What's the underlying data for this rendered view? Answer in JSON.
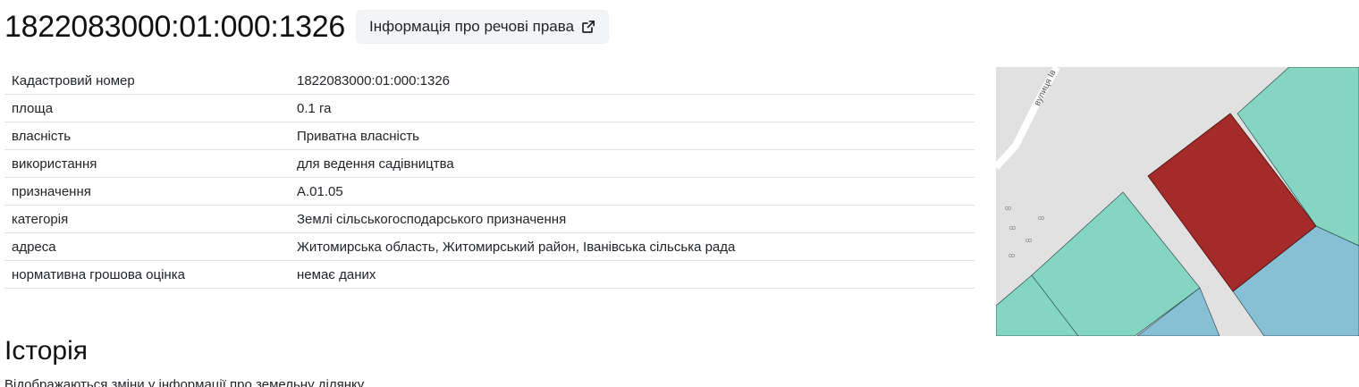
{
  "header": {
    "title": "1822083000:01:000:1326",
    "rights_button_label": "Інформація про речові права",
    "rights_button_icon": "external-link-icon"
  },
  "info_table": {
    "rows": [
      {
        "label": "Кадастровий номер",
        "value": "1822083000:01:000:1326"
      },
      {
        "label": "площа",
        "value": "0.1 га"
      },
      {
        "label": "власність",
        "value": "Приватна власність"
      },
      {
        "label": "використання",
        "value": "для ведення садівництва"
      },
      {
        "label": "призначення",
        "value": "А.01.05"
      },
      {
        "label": "категорія",
        "value": "Землі сільськогосподарського призначення"
      },
      {
        "label": "адреса",
        "value": "Житомирська область, Житомирський район, Іванівська сільська рада"
      },
      {
        "label": "нормативна грошова оцінка",
        "value": "немає даних"
      }
    ]
  },
  "map": {
    "street_label": "вулиця Ів",
    "colors": {
      "background": "#e1e1e1",
      "selected_parcel": "#a52a2a",
      "neighbor_parcel_green": "#84d5c1",
      "neighbor_parcel_blue": "#87bfd4",
      "road": "#ffffff"
    }
  },
  "history": {
    "title": "Історія",
    "description": "Відображаються зміни у інформації про земельну ділянку"
  }
}
